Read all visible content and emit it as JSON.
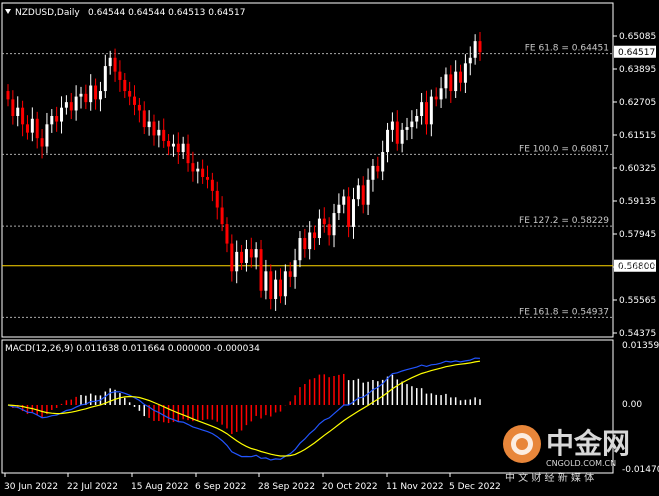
{
  "symbol_header": {
    "symbol": "NZDUSD,Daily",
    "ohlc": "0.64544 0.64544 0.64513 0.64517"
  },
  "macd_header": "MACD(12,26,9) 0.011638 0.011664 0.000000 -0.000034",
  "price_axis": [
    "0.65085",
    "0.63895",
    "0.62705",
    "0.61515",
    "0.60325",
    "0.59135",
    "0.57945",
    "0.56755",
    "0.55565",
    "0.54375"
  ],
  "current_price": "0.64517",
  "horizontal_line_label": "0.56800",
  "fib_levels": [
    {
      "label": "FE 61.8 = 0.64451",
      "price": 0.64451
    },
    {
      "label": "FE 100.0 = 0.60817",
      "price": 0.60817
    },
    {
      "label": "FE 127.2 = 0.58229",
      "price": 0.58229
    },
    {
      "label": "FE 161.8 = 0.54937",
      "price": 0.54937
    }
  ],
  "macd_axis": [
    "0.013594",
    "0.00",
    "-0.014703"
  ],
  "date_axis": [
    "30 Jun 2022",
    "22 Jul 2022",
    "15 Aug 2022",
    "6 Sep 2022",
    "28 Sep 2022",
    "20 Oct 2022",
    "11 Nov 2022",
    "5 Dec 2022"
  ],
  "watermark": {
    "brand": "中金网",
    "domain": "CNGOLD.COM.CN",
    "slogan": "中 文 财 经 新 媒 体"
  },
  "colors": {
    "bull": "#ffffff",
    "bear": "#ff0000",
    "fib_line": "#aaaaaa",
    "hline": "#ffd700",
    "signal": "#ffff00",
    "macd_line": "#2255ff"
  },
  "chart_data": {
    "type": "candlestick",
    "series_close": [
      0.628,
      0.622,
      0.625,
      0.619,
      0.616,
      0.621,
      0.614,
      0.611,
      0.619,
      0.622,
      0.62,
      0.625,
      0.627,
      0.624,
      0.629,
      0.63,
      0.627,
      0.633,
      0.628,
      0.631,
      0.64,
      0.643,
      0.638,
      0.635,
      0.631,
      0.629,
      0.626,
      0.624,
      0.618,
      0.62,
      0.615,
      0.617,
      0.613,
      0.611,
      0.612,
      0.609,
      0.612,
      0.605,
      0.602,
      0.603,
      0.6,
      0.599,
      0.595,
      0.589,
      0.583,
      0.576,
      0.566,
      0.573,
      0.569,
      0.574,
      0.571,
      0.574,
      0.559,
      0.566,
      0.556,
      0.563,
      0.557,
      0.566,
      0.564,
      0.57,
      0.578,
      0.574,
      0.58,
      0.578,
      0.585,
      0.583,
      0.579,
      0.587,
      0.59,
      0.593,
      0.582,
      0.592,
      0.597,
      0.59,
      0.599,
      0.604,
      0.602,
      0.609,
      0.617,
      0.62,
      0.612,
      0.617,
      0.618,
      0.62,
      0.622,
      0.627,
      0.619,
      0.629,
      0.628,
      0.632,
      0.637,
      0.631,
      0.638,
      0.634,
      0.641,
      0.643,
      0.649,
      0.645
    ],
    "fib_levels": [
      0.64451,
      0.60817,
      0.58229,
      0.54937
    ],
    "horizontal_line": 0.568,
    "macd": {
      "name": "MACD(12,26,9)",
      "main": 0.011638,
      "signal": 0.011664
    },
    "ylim": [
      0.54375,
      0.65085
    ]
  }
}
